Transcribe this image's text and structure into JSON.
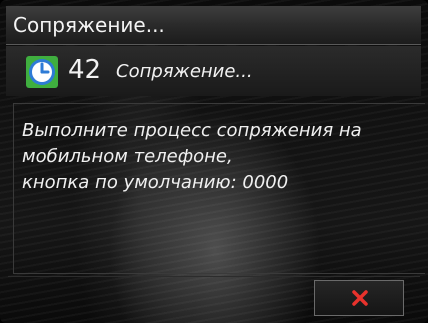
{
  "title_bar": {
    "title": "Сопряжение..."
  },
  "status": {
    "icon": "clock-icon",
    "count": "42",
    "text": "Сопряжение..."
  },
  "message": {
    "lines": [
      "Выполните процесс сопряжения на",
      "мобильном телефоне,",
      "кнопка по умолчанию: 0000"
    ]
  },
  "actions": {
    "close_icon": "close-icon"
  },
  "colors": {
    "clock_icon_bg": "#2e7bd6",
    "clock_icon_border": "#3fae3f",
    "close_icon": "#e8322c",
    "text": "#f0f0f0"
  }
}
